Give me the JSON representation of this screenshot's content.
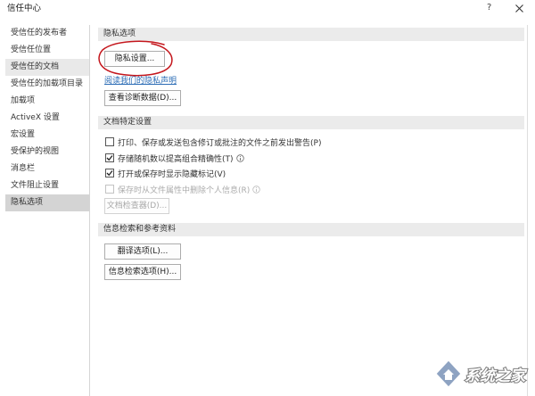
{
  "window": {
    "title": "信任中心",
    "help_label": "?",
    "close_icon": "close-icon"
  },
  "sidebar": {
    "items": [
      {
        "label": "受信任的发布者"
      },
      {
        "label": "受信任位置"
      },
      {
        "label": "受信任的文档",
        "highlighted": true
      },
      {
        "label": "受信任的加载项目录"
      },
      {
        "label": "加载项"
      },
      {
        "label": "ActiveX 设置"
      },
      {
        "label": "宏设置"
      },
      {
        "label": "受保护的视图"
      },
      {
        "label": "消息栏"
      },
      {
        "label": "文件阻止设置"
      },
      {
        "label": "隐私选项",
        "selected": true
      }
    ]
  },
  "privacy": {
    "header": "隐私选项",
    "privacy_settings_button": "隐私设置...",
    "privacy_statement_link": "阅读我们的隐私声明",
    "diagnostic_data_button": "查看诊断数据(D)..."
  },
  "document_settings": {
    "header": "文档特定设置",
    "options": [
      {
        "label": "打印、保存或发送包含修订或批注的文件之前发出警告(P)",
        "checked": false,
        "enabled": true,
        "info_icon": false
      },
      {
        "label": "存储随机数以提高组合精确性(T)",
        "checked": true,
        "enabled": true,
        "info_icon": true
      },
      {
        "label": "打开或保存时显示隐藏标记(V)",
        "checked": true,
        "enabled": true,
        "info_icon": false
      },
      {
        "label": "保存时从文件属性中删除个人信息(R)",
        "checked": false,
        "enabled": false,
        "info_icon": true
      }
    ],
    "document_inspector_button": "文档检查器(D)...",
    "document_inspector_enabled": false
  },
  "research": {
    "header": "信息检索和参考资料",
    "translation_options_button": "翻译选项(L)...",
    "research_options_button": "信息检索选项(H)..."
  },
  "watermark": {
    "text": "系统之家"
  },
  "colors": {
    "link": "#2b6cb5",
    "annotation": "#c4161c",
    "selected_row": "#d4d4d4",
    "highlighted_row": "#e9e9e9",
    "section_band": "#ebebeb"
  }
}
